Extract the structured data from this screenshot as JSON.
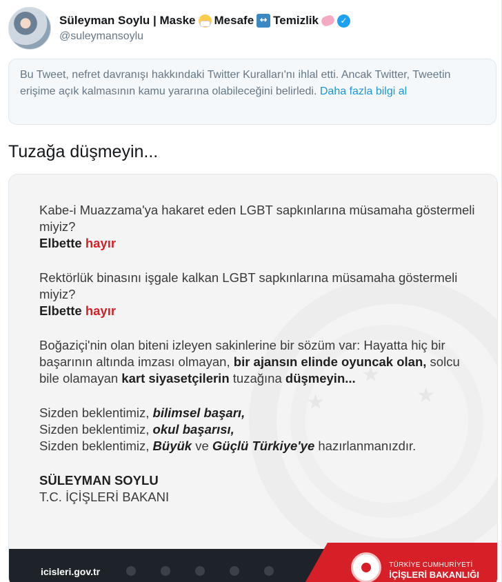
{
  "header": {
    "display_name": "Süleyman Soylu | Maske",
    "name_part_2": "Mesafe",
    "name_part_3": "Temizlik",
    "handle": "@suleymansoylu",
    "verified_icon": "verified-badge-icon"
  },
  "notice": {
    "text": "Bu Tweet, nefret davranışı hakkındaki Twitter Kuralları'nı ihlal etti. Ancak Twitter, Tweetin erişime açık kalmasının kamu yararına olabileceğini belirledi.",
    "link_label": "Daha fazla bilgi al"
  },
  "tweet": {
    "text": "Tuzağa düşmeyin..."
  },
  "media": {
    "p1_line": "Kabe-i Muazzama'ya hakaret eden LGBT sapkınlarına müsamaha göstermeli miyiz?",
    "p1_answer_a": "Elbette",
    "p1_answer_b": "hayır",
    "p2_line": "Rektörlük binasını işgale kalkan LGBT sapkınlarına müsamaha göstermeli miyiz?",
    "p2_answer_a": "Elbette",
    "p2_answer_b": "hayır",
    "p3_a": "Boğaziçi'nin olan biteni izleyen sakinlerine bir sözüm var: Hayatta hiç bir başarının altında imzası olmayan,",
    "p3_b": "bir ajansın elinde oyuncak olan,",
    "p3_c": "solcu bile olamayan",
    "p3_d": "kart siyasetçilerin",
    "p3_e": "tuzağına",
    "p3_f": "düşmeyin...",
    "e1_a": "Sizden beklentimiz,",
    "e1_b": "bilimsel başarı,",
    "e2_a": "Sizden beklentimiz,",
    "e2_b": "okul başarısı,",
    "e3_a": "Sizden beklentimiz,",
    "e3_b": "Büyük",
    "e3_c": "ve",
    "e3_d": "Güçlü Türkiye'ye",
    "e3_e": "hazırlanmanızdır.",
    "signature_name": "SÜLEYMAN SOYLU",
    "signature_title": "T.C. İÇİŞLERİ BAKANI",
    "footer_url": "icisleri.gov.tr",
    "ministry_line1": "TÜRKİYE CUMHURİYETİ",
    "ministry_line2": "İÇİŞLERİ BAKANLIĞI"
  },
  "colors": {
    "accent": "#1da1f2",
    "link": "#1b95e0",
    "red": "#d61f26",
    "footer_dark": "#1e2329"
  }
}
